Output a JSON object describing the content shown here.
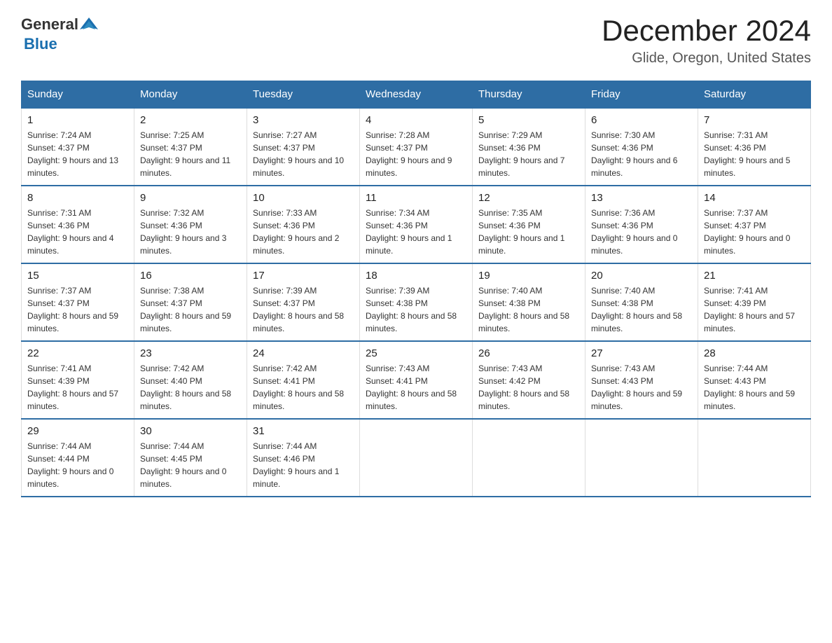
{
  "logo": {
    "general": "General",
    "blue": "Blue"
  },
  "title": "December 2024",
  "location": "Glide, Oregon, United States",
  "days_of_week": [
    "Sunday",
    "Monday",
    "Tuesday",
    "Wednesday",
    "Thursday",
    "Friday",
    "Saturday"
  ],
  "weeks": [
    [
      {
        "day": "1",
        "sunrise": "7:24 AM",
        "sunset": "4:37 PM",
        "daylight": "9 hours and 13 minutes."
      },
      {
        "day": "2",
        "sunrise": "7:25 AM",
        "sunset": "4:37 PM",
        "daylight": "9 hours and 11 minutes."
      },
      {
        "day": "3",
        "sunrise": "7:27 AM",
        "sunset": "4:37 PM",
        "daylight": "9 hours and 10 minutes."
      },
      {
        "day": "4",
        "sunrise": "7:28 AM",
        "sunset": "4:37 PM",
        "daylight": "9 hours and 9 minutes."
      },
      {
        "day": "5",
        "sunrise": "7:29 AM",
        "sunset": "4:36 PM",
        "daylight": "9 hours and 7 minutes."
      },
      {
        "day": "6",
        "sunrise": "7:30 AM",
        "sunset": "4:36 PM",
        "daylight": "9 hours and 6 minutes."
      },
      {
        "day": "7",
        "sunrise": "7:31 AM",
        "sunset": "4:36 PM",
        "daylight": "9 hours and 5 minutes."
      }
    ],
    [
      {
        "day": "8",
        "sunrise": "7:31 AM",
        "sunset": "4:36 PM",
        "daylight": "9 hours and 4 minutes."
      },
      {
        "day": "9",
        "sunrise": "7:32 AM",
        "sunset": "4:36 PM",
        "daylight": "9 hours and 3 minutes."
      },
      {
        "day": "10",
        "sunrise": "7:33 AM",
        "sunset": "4:36 PM",
        "daylight": "9 hours and 2 minutes."
      },
      {
        "day": "11",
        "sunrise": "7:34 AM",
        "sunset": "4:36 PM",
        "daylight": "9 hours and 1 minute."
      },
      {
        "day": "12",
        "sunrise": "7:35 AM",
        "sunset": "4:36 PM",
        "daylight": "9 hours and 1 minute."
      },
      {
        "day": "13",
        "sunrise": "7:36 AM",
        "sunset": "4:36 PM",
        "daylight": "9 hours and 0 minutes."
      },
      {
        "day": "14",
        "sunrise": "7:37 AM",
        "sunset": "4:37 PM",
        "daylight": "9 hours and 0 minutes."
      }
    ],
    [
      {
        "day": "15",
        "sunrise": "7:37 AM",
        "sunset": "4:37 PM",
        "daylight": "8 hours and 59 minutes."
      },
      {
        "day": "16",
        "sunrise": "7:38 AM",
        "sunset": "4:37 PM",
        "daylight": "8 hours and 59 minutes."
      },
      {
        "day": "17",
        "sunrise": "7:39 AM",
        "sunset": "4:37 PM",
        "daylight": "8 hours and 58 minutes."
      },
      {
        "day": "18",
        "sunrise": "7:39 AM",
        "sunset": "4:38 PM",
        "daylight": "8 hours and 58 minutes."
      },
      {
        "day": "19",
        "sunrise": "7:40 AM",
        "sunset": "4:38 PM",
        "daylight": "8 hours and 58 minutes."
      },
      {
        "day": "20",
        "sunrise": "7:40 AM",
        "sunset": "4:38 PM",
        "daylight": "8 hours and 58 minutes."
      },
      {
        "day": "21",
        "sunrise": "7:41 AM",
        "sunset": "4:39 PM",
        "daylight": "8 hours and 57 minutes."
      }
    ],
    [
      {
        "day": "22",
        "sunrise": "7:41 AM",
        "sunset": "4:39 PM",
        "daylight": "8 hours and 57 minutes."
      },
      {
        "day": "23",
        "sunrise": "7:42 AM",
        "sunset": "4:40 PM",
        "daylight": "8 hours and 58 minutes."
      },
      {
        "day": "24",
        "sunrise": "7:42 AM",
        "sunset": "4:41 PM",
        "daylight": "8 hours and 58 minutes."
      },
      {
        "day": "25",
        "sunrise": "7:43 AM",
        "sunset": "4:41 PM",
        "daylight": "8 hours and 58 minutes."
      },
      {
        "day": "26",
        "sunrise": "7:43 AM",
        "sunset": "4:42 PM",
        "daylight": "8 hours and 58 minutes."
      },
      {
        "day": "27",
        "sunrise": "7:43 AM",
        "sunset": "4:43 PM",
        "daylight": "8 hours and 59 minutes."
      },
      {
        "day": "28",
        "sunrise": "7:44 AM",
        "sunset": "4:43 PM",
        "daylight": "8 hours and 59 minutes."
      }
    ],
    [
      {
        "day": "29",
        "sunrise": "7:44 AM",
        "sunset": "4:44 PM",
        "daylight": "9 hours and 0 minutes."
      },
      {
        "day": "30",
        "sunrise": "7:44 AM",
        "sunset": "4:45 PM",
        "daylight": "9 hours and 0 minutes."
      },
      {
        "day": "31",
        "sunrise": "7:44 AM",
        "sunset": "4:46 PM",
        "daylight": "9 hours and 1 minute."
      },
      null,
      null,
      null,
      null
    ]
  ]
}
